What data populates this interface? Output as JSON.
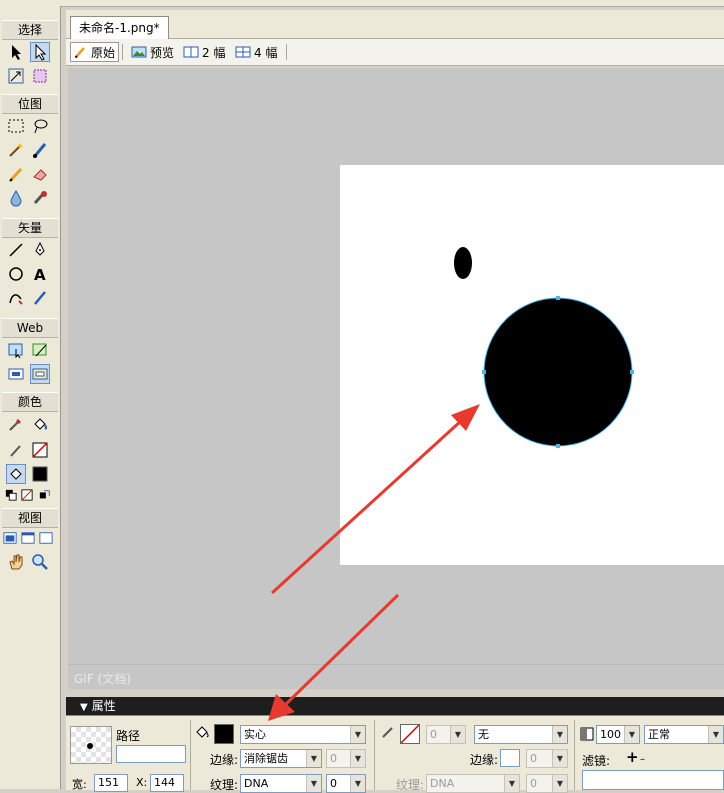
{
  "app": {
    "accent": "#316ac5"
  },
  "toolbox": {
    "sections": [
      "选择",
      "位图",
      "矢量",
      "Web",
      "颜色",
      "视图"
    ]
  },
  "document": {
    "tab_title": "未命名-1.png*",
    "views": [
      "原始",
      "预览",
      "2 幅",
      "4 幅"
    ],
    "status_label": "GIF (文档)"
  },
  "canvas": {
    "background": "#c6c6c6",
    "artboard_color": "#ffffff",
    "selected_shape": "circle",
    "selection_color": "#4fb3e8",
    "fill_color": "#000000"
  },
  "properties": {
    "title": "属性",
    "object_type": "路径",
    "object_name": "",
    "fill_type": "实心",
    "edge_label": "边缘:",
    "edge_value": "消除锯齿",
    "edge_amount": "0",
    "texture_label": "纹理:",
    "texture_value": "DNA",
    "texture_amount": "0",
    "stroke_size": "0",
    "stroke_type": "无",
    "stroke_edge_label": "边缘:",
    "stroke_edge_amount": "0",
    "stroke_texture_label": "纹理:",
    "stroke_texture_value": "DNA",
    "stroke_texture_amount": "0",
    "opacity": "100",
    "blend_mode": "正常",
    "filters_label": "滤镜:",
    "width_label": "宽:",
    "width_value": "151",
    "x_label": "X:",
    "x_value": "144"
  },
  "annotations": {
    "arrow_color": "#e8392f"
  }
}
